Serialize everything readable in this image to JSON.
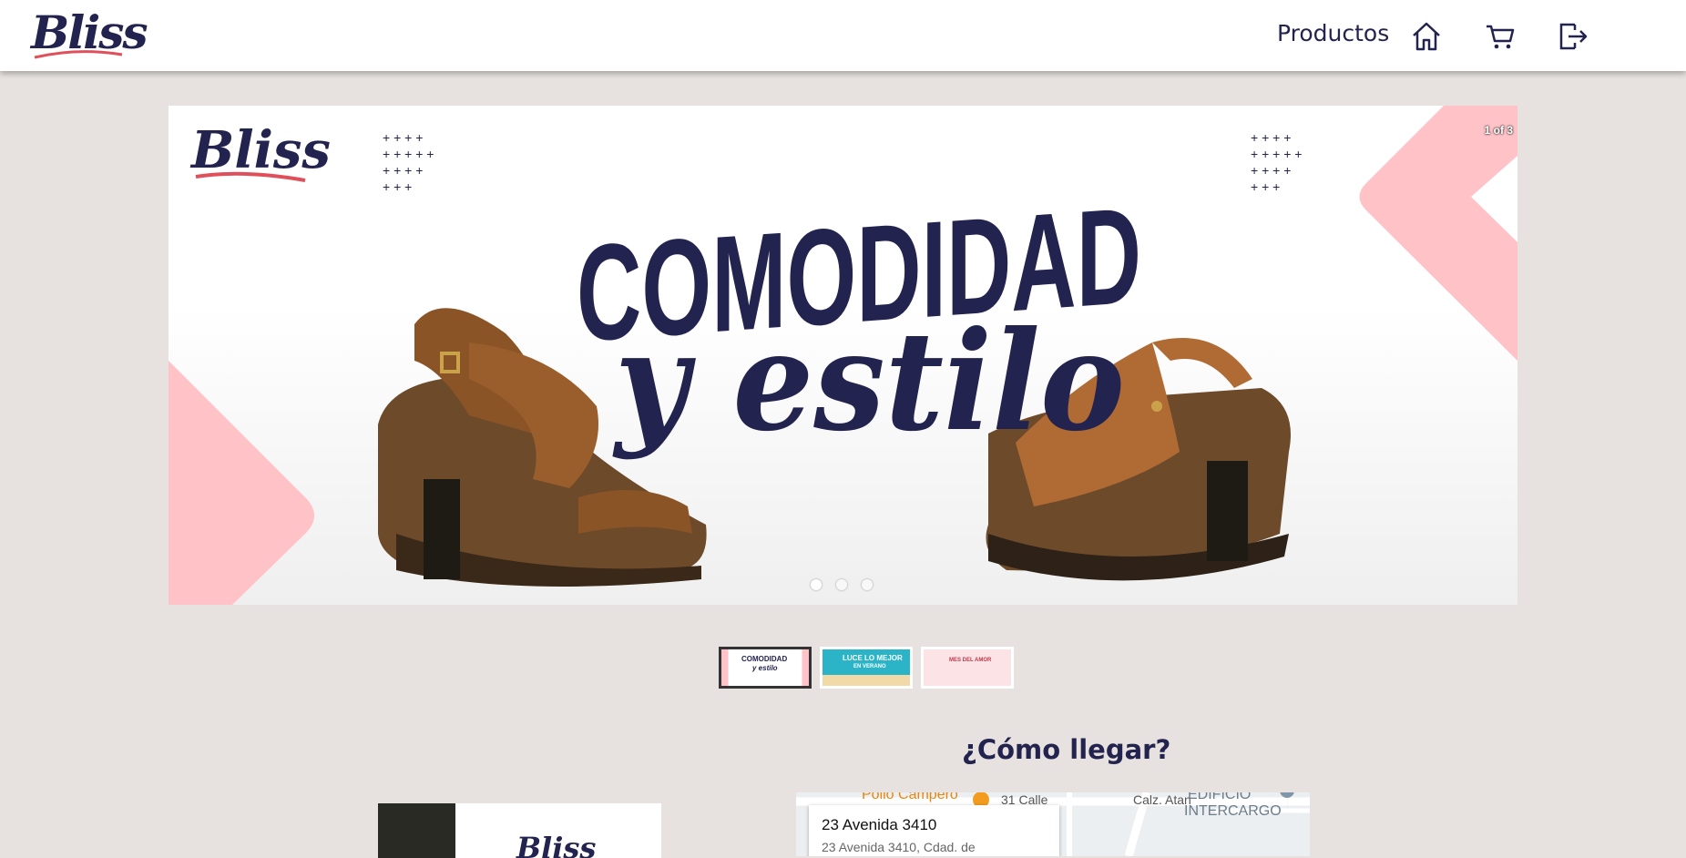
{
  "header": {
    "logo": "Bliss",
    "nav_products": "Productos",
    "icons": [
      "home-icon",
      "cart-icon",
      "logout-icon"
    ]
  },
  "carousel": {
    "counter": "1 of 3",
    "slide": {
      "brand": "Bliss",
      "headline": "COMODIDAD",
      "tagline": "y estilo"
    },
    "dots": 3,
    "active_index": 0
  },
  "thumbnails": [
    {
      "line1": "COMODIDAD",
      "line2": "y estilo"
    },
    {
      "line1": "LUCE LO MEJOR",
      "line2": "EN VERANO"
    },
    {
      "line1": "MES DEL AMOR",
      "line2": ""
    }
  ],
  "location": {
    "heading": "¿Cómo llegar?",
    "map": {
      "poi_1": "Pollo Campero",
      "street_1": "31 Calle",
      "street_2": "Calz. Atan",
      "poi_2": "EDIFICIO",
      "poi_2b": "INTERCARGO",
      "card_title": "23 Avenida 3410",
      "card_address": "23 Avenida 3410, Cdad. de"
    }
  },
  "promo": {
    "logo": "Bliss"
  },
  "colors": {
    "brand_navy": "#23234f",
    "accent_pink": "#ffc2c6",
    "page_bg": "#e7e2df"
  }
}
